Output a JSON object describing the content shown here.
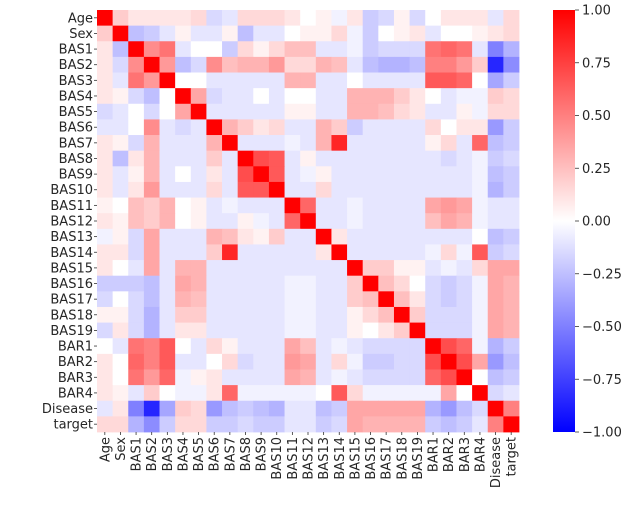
{
  "chart_data": {
    "type": "heatmap",
    "title": "",
    "xlabel": "",
    "ylabel": "",
    "labels": [
      "Age",
      "Sex",
      "BAS1",
      "BAS2",
      "BAS3",
      "BAS4",
      "BAS5",
      "BAS6",
      "BAS7",
      "BAS8",
      "BAS9",
      "BAS10",
      "BAS11",
      "BAS12",
      "BAS13",
      "BAS14",
      "BAS15",
      "BAS16",
      "BAS17",
      "BAS18",
      "BAS19",
      "BAR1",
      "BAR2",
      "BAR3",
      "BAR4",
      "Disease",
      "target"
    ],
    "colormap": "bwr",
    "colors": {
      "low": "#0000ff",
      "mid": "#ffffff",
      "high": "#ff0000"
    },
    "vmin": -1.0,
    "vmax": 1.0,
    "colorbar": {
      "placement": "right",
      "ticks": [
        1.0,
        0.75,
        0.5,
        0.25,
        0.0,
        -0.25,
        -0.5,
        -0.75,
        -1.0
      ],
      "tick_labels": [
        "1.00",
        "0.75",
        "0.50",
        "0.25",
        "0.00",
        "−0.25",
        "−0.50",
        "−0.75",
        "−1.00"
      ]
    },
    "matrix": [
      [
        1.0,
        0.2,
        0.1,
        0.1,
        0.1,
        0.1,
        0.15,
        -0.15,
        -0.1,
        0.15,
        0.15,
        0.15,
        0.1,
        0.0,
        0.05,
        -0.05,
        0.1,
        -0.2,
        -0.15,
        0.05,
        -0.15,
        0.0,
        0.1,
        0.1,
        0.1,
        -0.1,
        0.15
      ],
      [
        0.2,
        1.0,
        -0.25,
        -0.2,
        -0.1,
        0.05,
        -0.1,
        -0.1,
        0.05,
        -0.25,
        -0.1,
        -0.1,
        0.0,
        0.05,
        0.05,
        0.15,
        -0.05,
        -0.2,
        0.0,
        0.05,
        0.1,
        -0.1,
        0.0,
        0.0,
        0.05,
        0.1,
        0.15
      ],
      [
        0.1,
        -0.25,
        1.0,
        0.45,
        0.55,
        -0.1,
        0.0,
        0.0,
        -0.2,
        0.15,
        0.05,
        0.15,
        0.25,
        0.25,
        -0.1,
        -0.1,
        -0.05,
        -0.2,
        -0.15,
        -0.15,
        -0.15,
        0.55,
        0.6,
        0.55,
        -0.1,
        -0.5,
        -0.3
      ],
      [
        0.1,
        -0.15,
        0.45,
        1.0,
        0.4,
        -0.25,
        -0.15,
        0.45,
        0.25,
        0.3,
        0.3,
        0.4,
        0.15,
        0.15,
        0.3,
        0.25,
        -0.1,
        -0.25,
        -0.3,
        -0.3,
        -0.25,
        0.5,
        0.5,
        0.4,
        0.2,
        -0.85,
        -0.45
      ],
      [
        0.1,
        -0.1,
        0.55,
        0.4,
        1.0,
        0.0,
        0.0,
        -0.1,
        -0.1,
        -0.1,
        -0.1,
        -0.1,
        0.3,
        0.3,
        -0.1,
        -0.1,
        0.0,
        -0.1,
        -0.1,
        -0.1,
        -0.1,
        0.65,
        0.65,
        0.6,
        0.0,
        -0.35,
        -0.2
      ],
      [
        0.1,
        0.05,
        -0.15,
        -0.25,
        0.0,
        1.0,
        0.35,
        -0.15,
        -0.1,
        -0.1,
        0.0,
        -0.1,
        0.0,
        0.0,
        -0.1,
        -0.1,
        0.3,
        0.3,
        0.3,
        0.2,
        0.1,
        0.0,
        -0.1,
        -0.05,
        -0.05,
        0.2,
        0.15
      ],
      [
        -0.15,
        -0.1,
        0.0,
        -0.15,
        0.0,
        0.35,
        1.0,
        -0.1,
        -0.1,
        -0.1,
        -0.1,
        -0.1,
        0.05,
        0.05,
        -0.1,
        -0.1,
        0.3,
        0.3,
        0.25,
        0.15,
        0.1,
        -0.1,
        -0.1,
        0.05,
        -0.05,
        0.15,
        0.15
      ],
      [
        -0.1,
        -0.1,
        0.0,
        0.45,
        -0.1,
        -0.15,
        -0.1,
        1.0,
        0.3,
        0.2,
        0.1,
        0.15,
        -0.1,
        -0.1,
        0.3,
        0.2,
        -0.2,
        -0.1,
        -0.1,
        -0.1,
        -0.1,
        0.15,
        0.0,
        0.1,
        0.1,
        -0.4,
        -0.2
      ],
      [
        0.1,
        0.05,
        -0.15,
        0.3,
        -0.1,
        -0.1,
        -0.1,
        0.3,
        1.0,
        -0.1,
        -0.1,
        -0.1,
        -0.05,
        -0.1,
        0.3,
        0.85,
        -0.1,
        -0.1,
        -0.1,
        -0.1,
        -0.1,
        0.05,
        0.15,
        -0.1,
        0.6,
        -0.25,
        -0.2
      ],
      [
        0.1,
        -0.25,
        0.1,
        0.3,
        -0.1,
        -0.1,
        -0.1,
        0.2,
        -0.1,
        1.0,
        0.7,
        0.65,
        -0.1,
        0.05,
        -0.1,
        -0.1,
        -0.1,
        -0.1,
        -0.1,
        -0.1,
        -0.1,
        -0.1,
        -0.15,
        -0.1,
        -0.05,
        -0.2,
        -0.15
      ],
      [
        0.1,
        -0.1,
        0.05,
        0.3,
        -0.1,
        0.0,
        -0.1,
        0.1,
        -0.1,
        0.7,
        1.0,
        0.65,
        -0.1,
        -0.05,
        0.05,
        -0.1,
        -0.1,
        -0.1,
        -0.1,
        -0.1,
        -0.1,
        -0.1,
        -0.1,
        -0.1,
        -0.05,
        -0.25,
        -0.2
      ],
      [
        0.1,
        -0.1,
        0.1,
        0.4,
        -0.1,
        -0.1,
        -0.1,
        0.15,
        -0.1,
        0.65,
        0.65,
        1.0,
        -0.1,
        -0.1,
        0.15,
        -0.1,
        -0.1,
        -0.1,
        -0.1,
        -0.1,
        -0.1,
        -0.1,
        -0.1,
        -0.1,
        -0.05,
        -0.3,
        -0.2
      ],
      [
        0.05,
        0.0,
        0.25,
        0.2,
        0.3,
        0.0,
        0.05,
        -0.1,
        -0.05,
        -0.1,
        -0.1,
        -0.1,
        1.0,
        0.6,
        -0.1,
        -0.1,
        -0.05,
        -0.1,
        -0.1,
        -0.1,
        -0.1,
        0.35,
        0.4,
        0.35,
        -0.05,
        -0.1,
        -0.1
      ],
      [
        0.1,
        0.05,
        0.25,
        0.2,
        0.3,
        0.0,
        0.05,
        -0.1,
        -0.1,
        0.05,
        -0.05,
        -0.1,
        0.6,
        1.0,
        -0.1,
        -0.1,
        -0.05,
        -0.1,
        -0.1,
        -0.1,
        -0.1,
        0.25,
        0.35,
        0.3,
        -0.05,
        -0.1,
        -0.1
      ],
      [
        -0.05,
        0.05,
        -0.15,
        0.35,
        -0.1,
        -0.1,
        -0.1,
        0.3,
        0.25,
        0.1,
        0.05,
        0.2,
        -0.1,
        -0.1,
        1.0,
        0.1,
        -0.1,
        -0.1,
        -0.1,
        -0.1,
        -0.1,
        -0.1,
        -0.1,
        -0.1,
        0.0,
        -0.25,
        -0.2
      ],
      [
        0.1,
        0.1,
        -0.15,
        0.35,
        -0.1,
        -0.1,
        -0.1,
        0.2,
        0.85,
        -0.1,
        -0.1,
        -0.1,
        -0.1,
        -0.1,
        0.1,
        1.0,
        -0.1,
        -0.1,
        -0.1,
        -0.1,
        -0.1,
        -0.05,
        0.15,
        -0.05,
        0.65,
        -0.2,
        -0.15
      ],
      [
        0.1,
        0.0,
        -0.1,
        0.35,
        -0.1,
        0.3,
        0.3,
        -0.1,
        -0.1,
        -0.1,
        -0.1,
        -0.1,
        -0.1,
        -0.1,
        -0.1,
        -0.1,
        1.0,
        0.2,
        0.2,
        0.05,
        0.05,
        -0.1,
        -0.05,
        -0.1,
        0.15,
        0.35,
        0.35
      ],
      [
        -0.2,
        -0.2,
        -0.2,
        -0.25,
        -0.1,
        0.35,
        0.3,
        -0.1,
        -0.1,
        -0.1,
        -0.1,
        -0.1,
        -0.05,
        -0.05,
        -0.1,
        -0.1,
        0.2,
        1.0,
        0.25,
        0.15,
        0.0,
        -0.15,
        -0.2,
        -0.15,
        -0.05,
        0.35,
        0.3
      ],
      [
        -0.15,
        0.0,
        -0.15,
        -0.25,
        -0.1,
        0.3,
        0.25,
        -0.1,
        -0.1,
        -0.1,
        -0.1,
        -0.1,
        -0.05,
        -0.05,
        -0.1,
        -0.1,
        0.2,
        0.25,
        1.0,
        0.25,
        0.1,
        -0.15,
        -0.2,
        -0.15,
        -0.05,
        0.35,
        0.3
      ],
      [
        0.05,
        0.05,
        -0.15,
        -0.3,
        -0.1,
        0.2,
        0.2,
        -0.1,
        -0.1,
        -0.1,
        -0.1,
        -0.1,
        -0.05,
        -0.05,
        -0.1,
        -0.1,
        0.05,
        0.15,
        0.25,
        1.0,
        0.2,
        -0.15,
        -0.15,
        -0.15,
        -0.05,
        0.35,
        0.3
      ],
      [
        -0.15,
        0.1,
        -0.15,
        -0.3,
        -0.1,
        0.1,
        0.1,
        -0.1,
        -0.1,
        -0.1,
        -0.1,
        -0.1,
        -0.05,
        -0.05,
        -0.1,
        -0.1,
        0.05,
        0.0,
        0.1,
        0.2,
        1.0,
        -0.15,
        -0.15,
        -0.15,
        -0.05,
        0.35,
        0.3
      ],
      [
        0.0,
        -0.1,
        0.55,
        0.5,
        0.65,
        0.0,
        -0.1,
        0.15,
        0.05,
        -0.1,
        -0.1,
        -0.1,
        0.35,
        0.25,
        -0.1,
        -0.05,
        -0.1,
        -0.15,
        -0.15,
        -0.15,
        -0.15,
        1.0,
        0.7,
        0.6,
        -0.05,
        -0.3,
        -0.2
      ],
      [
        0.1,
        0.0,
        0.6,
        0.5,
        0.65,
        -0.1,
        -0.1,
        0.0,
        0.15,
        -0.15,
        -0.1,
        -0.1,
        0.4,
        0.35,
        -0.1,
        0.15,
        -0.05,
        -0.2,
        -0.2,
        -0.15,
        -0.15,
        0.7,
        1.0,
        0.7,
        0.35,
        -0.4,
        -0.25
      ],
      [
        0.1,
        0.0,
        0.55,
        0.4,
        0.6,
        -0.05,
        0.05,
        0.1,
        -0.1,
        -0.1,
        -0.1,
        -0.1,
        0.35,
        0.3,
        -0.1,
        -0.05,
        -0.1,
        -0.15,
        -0.15,
        -0.15,
        -0.15,
        0.6,
        0.7,
        1.0,
        0.0,
        -0.25,
        -0.2
      ],
      [
        0.1,
        0.05,
        -0.1,
        0.2,
        0.0,
        -0.05,
        -0.05,
        0.1,
        0.6,
        -0.05,
        -0.05,
        -0.05,
        -0.05,
        -0.05,
        0.0,
        0.65,
        0.15,
        -0.05,
        -0.05,
        -0.05,
        -0.05,
        -0.05,
        0.35,
        0.0,
        1.0,
        -0.15,
        -0.1
      ],
      [
        -0.1,
        0.1,
        -0.5,
        -0.85,
        -0.35,
        0.2,
        0.15,
        -0.4,
        -0.25,
        -0.2,
        -0.25,
        -0.3,
        -0.1,
        -0.1,
        -0.25,
        -0.2,
        0.35,
        0.35,
        0.35,
        0.35,
        0.35,
        -0.3,
        -0.4,
        -0.25,
        -0.15,
        1.0,
        0.5
      ],
      [
        0.15,
        0.15,
        -0.3,
        -0.45,
        -0.2,
        0.15,
        0.15,
        -0.2,
        -0.2,
        -0.15,
        -0.2,
        -0.2,
        -0.1,
        -0.1,
        -0.2,
        -0.15,
        0.35,
        0.3,
        0.3,
        0.3,
        0.3,
        -0.2,
        -0.25,
        -0.2,
        -0.1,
        0.5,
        1.0
      ]
    ]
  },
  "footer": {
    "corner_glyph": "·"
  }
}
